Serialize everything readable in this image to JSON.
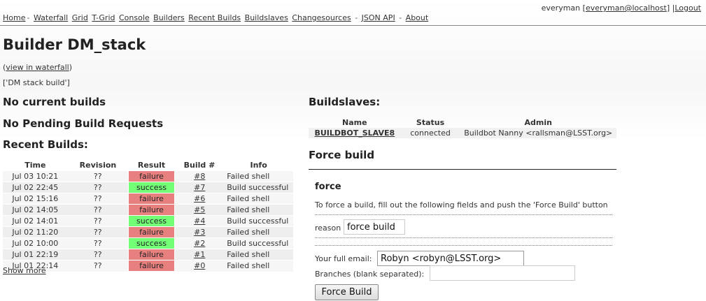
{
  "nav": {
    "links": [
      "Home",
      "Waterfall",
      "Grid",
      "T-Grid",
      "Console",
      "Builders",
      "Recent Builds",
      "Buildslaves",
      "Changesources",
      "JSON API",
      "About"
    ],
    "separator": "-"
  },
  "user": {
    "name": "everyman",
    "email": "everyman@localhost",
    "logout": "Logout"
  },
  "page": {
    "title": "Builder DM_stack",
    "view_waterfall": "view in waterfall",
    "description": "['DM stack build']"
  },
  "sections": {
    "current": "No current builds",
    "pending": "No Pending Build Requests",
    "recent": "Recent Builds:",
    "buildslaves": "Buildslaves:",
    "force_build": "Force build"
  },
  "builds": {
    "columns": [
      "Time",
      "Revision",
      "Result",
      "Build #",
      "Info"
    ],
    "rows": [
      {
        "time": "Jul 03 10:21",
        "rev": "??",
        "result": "failure",
        "num": "#8",
        "info": "Failed shell"
      },
      {
        "time": "Jul 02 22:45",
        "rev": "??",
        "result": "success",
        "num": "#7",
        "info": "Build successful"
      },
      {
        "time": "Jul 02 15:16",
        "rev": "??",
        "result": "failure",
        "num": "#6",
        "info": "Failed shell"
      },
      {
        "time": "Jul 02 14:05",
        "rev": "??",
        "result": "failure",
        "num": "#5",
        "info": "Failed shell"
      },
      {
        "time": "Jul 02 14:01",
        "rev": "??",
        "result": "success",
        "num": "#4",
        "info": "Build successful"
      },
      {
        "time": "Jul 02 11:20",
        "rev": "??",
        "result": "failure",
        "num": "#3",
        "info": "Failed shell"
      },
      {
        "time": "Jul 02 10:00",
        "rev": "??",
        "result": "success",
        "num": "#2",
        "info": "Build successful"
      },
      {
        "time": "Jul 01 22:19",
        "rev": "??",
        "result": "failure",
        "num": "#1",
        "info": "Failed shell"
      },
      {
        "time": "Jul 01 22:14",
        "rev": "??",
        "result": "failure",
        "num": "#0",
        "info": "Failed shell"
      }
    ],
    "show_more": "Show more"
  },
  "slaves": {
    "columns": [
      "Name",
      "Status",
      "Admin"
    ],
    "rows": [
      {
        "name": "BUILDBOT_SLAVE8",
        "status": "connected",
        "admin": "Buildbot Nanny <rallsman@LSST.org>"
      }
    ]
  },
  "force": {
    "heading": "force",
    "instructions": "To force a build, fill out the following fields and push the 'Force Build' button",
    "reason_label": "reason",
    "reason_value": "force build",
    "email_label": "Your full email:",
    "email_value": "Robyn <robyn@LSST.org>",
    "branches_label": "Branches (blank separated):",
    "branches_value": "",
    "button": "Force Build"
  },
  "colors": {
    "failure": "#e98080",
    "success": "#72ff75"
  }
}
